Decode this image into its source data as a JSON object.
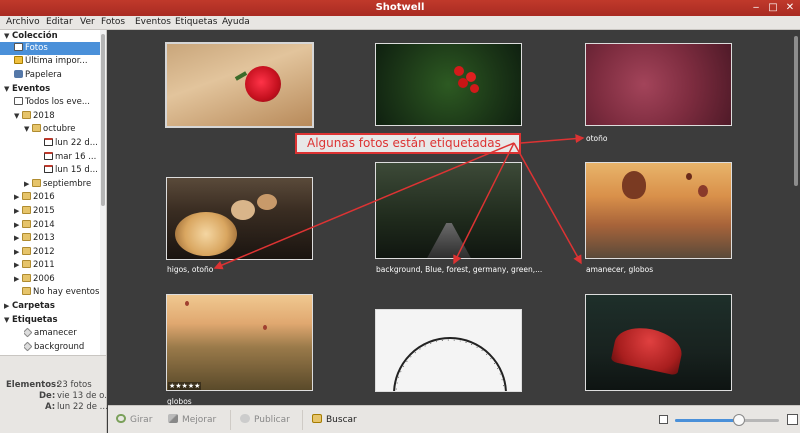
{
  "window": {
    "title": "Shotwell"
  },
  "menu": [
    "Archivo",
    "Editar",
    "Ver",
    "Fotos",
    "Eventos",
    "Etiquetas",
    "Ayuda"
  ],
  "sidebar": {
    "coleccion": "Colección",
    "fotos": "Fotos",
    "ultima": "Última impor...",
    "papelera": "Papelera",
    "eventos": "Eventos",
    "todos": "Todos los eve...",
    "y2018": "2018",
    "octubre": "octubre",
    "lun22": "lun 22 d...",
    "mar16": "mar 16 ...",
    "lun15": "lun 15 d...",
    "septiembre": "septiembre",
    "y2016": "2016",
    "y2015": "2015",
    "y2014": "2014",
    "y2013": "2013",
    "y2012": "2012",
    "y2011": "2011",
    "y2006": "2006",
    "nohay": "No hay eventos",
    "carpetas": "Carpetas",
    "etiquetas": "Etiquetas",
    "amanecer": "amanecer",
    "background": "background"
  },
  "info": {
    "elementos_k": "Elementos:",
    "elementos_v": "23 fotos",
    "de_k": "De:",
    "de_v": "vie 13 de o...",
    "a_k": "A:",
    "a_v": "lun 22 de ..."
  },
  "captions": {
    "otono": "otoño",
    "higos": "higos, otoño",
    "forest": "background, Blue, forest, germany, green,...",
    "amanecer": "amanecer, globos",
    "globos": "globos"
  },
  "rating": "★★★★★",
  "annotation": "Algunas fotos están etiquetadas",
  "toolbar": {
    "girar": "Girar",
    "mejorar": "Mejorar",
    "publicar": "Publicar",
    "buscar": "Buscar"
  },
  "zoom": {
    "level": 0.62
  },
  "colors": {
    "titlebar": "#b5342a",
    "selection": "#4a90d9",
    "annotation": "#dd3333"
  }
}
